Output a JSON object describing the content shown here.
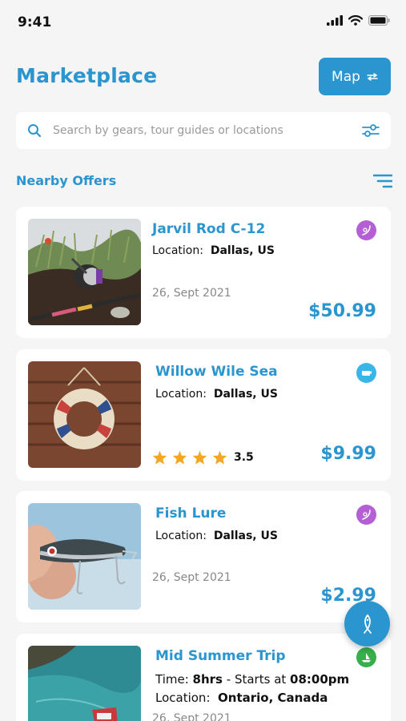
{
  "status_bar": {
    "time": "9:41"
  },
  "header": {
    "title": "Marketplace",
    "map_label": "Map"
  },
  "search": {
    "placeholder": "Search by gears, tour guides or locations"
  },
  "section": {
    "title": "Nearby Offers"
  },
  "offers": [
    {
      "title": "Jarvil Rod C-12",
      "location_label": "Location:",
      "location": "Dallas, US",
      "date": "26, Sept 2021",
      "price": "$50.99",
      "badge": "fishing-rod-icon",
      "badge_color": "#b45fd4"
    },
    {
      "title": "Willow Wile Sea",
      "location_label": "Location:",
      "location": "Dallas, US",
      "rating": "3.5",
      "rating_stars": 4,
      "price": "$9.99",
      "badge": "sea-icon",
      "badge_color": "#38b6ea"
    },
    {
      "title": "Fish Lure",
      "location_label": "Location:",
      "location": "Dallas, US",
      "date": "26, Sept 2021",
      "price": "$2.99",
      "badge": "fishing-rod-icon",
      "badge_color": "#b45fd4"
    },
    {
      "title": "Mid Summer Trip",
      "time_label": "Time:",
      "time": "8hrs",
      "starts_label": "- Starts at",
      "starts": "08:00pm",
      "location_label": "Location:",
      "location": "Ontario, Canada",
      "date": "26, Sept 2021",
      "badge": "boat-icon",
      "badge_color": "#36b04b"
    }
  ],
  "colors": {
    "accent": "#2b95cf",
    "star": "#f5a623"
  }
}
